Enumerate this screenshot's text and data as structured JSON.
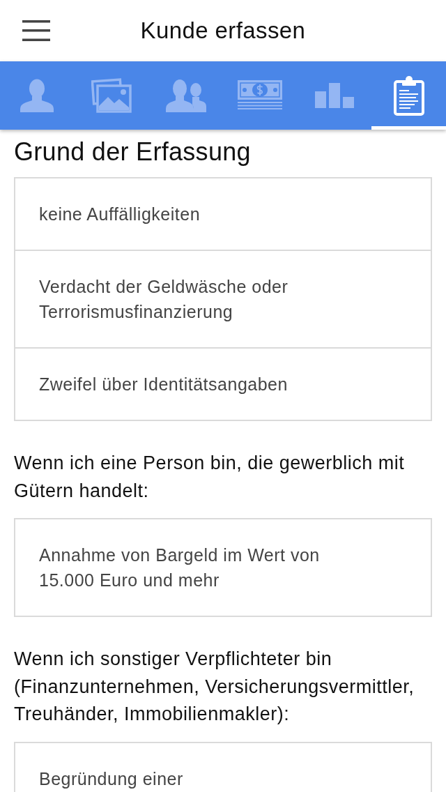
{
  "header": {
    "title": "Kunde erfassen"
  },
  "tabs": [
    {
      "selected": false
    },
    {
      "selected": false
    },
    {
      "selected": false
    },
    {
      "selected": false
    },
    {
      "selected": false
    },
    {
      "selected": true
    }
  ],
  "sections": [
    {
      "title": "Grund der Erfassung",
      "options": [
        {
          "text": "keine Auffälligkeiten",
          "selected": false
        },
        {
          "text": "Verdacht der Geldwäsche oder Terrorismusfinanzierung",
          "selected": false
        },
        {
          "text": "Zweifel über Identitätsangaben",
          "selected": false
        }
      ]
    },
    {
      "intro": "Wenn ich eine Person bin, die gewerblich mit Gütern handelt:",
      "options": [
        {
          "text": "Annahme von Bargeld im Wert von 15.000 Euro und mehr",
          "selected": false
        }
      ]
    },
    {
      "intro": "Wenn ich sonstiger Verpflichteter bin (Finanzunternehmen, Versicherungsvermittler, Treuhänder, Immobilienmakler):",
      "options": [
        {
          "text": "Begründung einer",
          "selected": false
        }
      ]
    }
  ]
}
